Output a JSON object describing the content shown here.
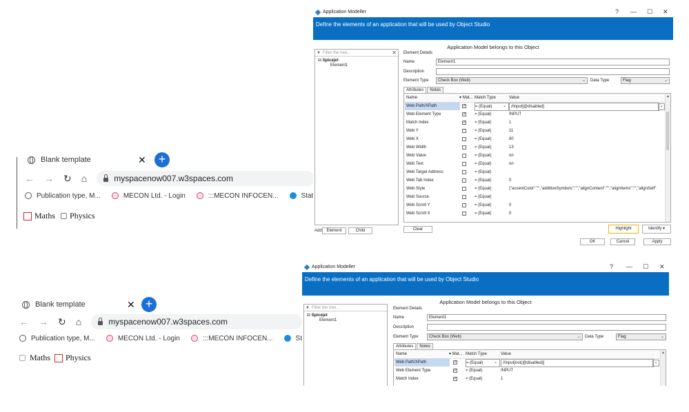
{
  "browser_top": {
    "tab_title": "Blank template",
    "tab_close": "✕",
    "new_tab": "+",
    "url": "myspacenow007.w3spaces.com",
    "bookmarks": [
      "Publication type, M...",
      "MECON Ltd. - Login",
      ":::MECON INFOCEN...",
      "State Bank of"
    ],
    "checkboxes": [
      {
        "label": "Maths",
        "checked": false,
        "highlighted": true
      },
      {
        "label": "Physics",
        "checked": false,
        "highlighted": false
      }
    ]
  },
  "browser_bottom": {
    "tab_title": "Blank template",
    "tab_close": "✕",
    "new_tab": "+",
    "url": "myspacenow007.w3spaces.com",
    "bookmarks": [
      "Publication type, M...",
      "MECON Ltd. - Login",
      ":::MECON INFOCEN...",
      "State Bank of Inc"
    ],
    "checkboxes": [
      {
        "label": "Maths",
        "checked": false,
        "highlighted": false
      },
      {
        "label": "Physics",
        "checked": false,
        "highlighted": true
      }
    ]
  },
  "modeller_top": {
    "title": "Application Modeller",
    "controls": [
      "?",
      "—",
      "☐",
      "✕"
    ],
    "banner": "Define the elements of an application that will be used by Object Studio",
    "subheader": "Application Model belongs to this Object",
    "filter_placeholder": "Filter the tree...",
    "tree_root": "Spicejet",
    "tree_child": "Element1",
    "element_details_label": "Element Details",
    "name_label": "Name",
    "name_value": "Element1",
    "description_label": "Description",
    "description_value": "",
    "element_type_label": "Element Type",
    "element_type_value": "Check Box (Web)",
    "data_type_label": "Data Type",
    "data_type_value": "Flag",
    "tabs": [
      "Attributes",
      "Notes"
    ],
    "columns": [
      "Name",
      "Mat...",
      "Match Type",
      "Value"
    ],
    "rows": [
      {
        "name": "Web Path/XPath",
        "match": true,
        "type": "= (Equal)",
        "value": "//input[@disabled]"
      },
      {
        "name": "Web Element Type",
        "match": true,
        "type": "= (Equal)",
        "value": "INPUT"
      },
      {
        "name": "Match Index",
        "match": true,
        "type": "= (Equal)",
        "value": "1"
      },
      {
        "name": "Web Y",
        "match": false,
        "type": "= (Equal)",
        "value": "11"
      },
      {
        "name": "Web X",
        "match": false,
        "type": "= (Equal)",
        "value": "80"
      },
      {
        "name": "Web Width",
        "match": false,
        "type": "= (Equal)",
        "value": "13"
      },
      {
        "name": "Web Value",
        "match": false,
        "type": "= (Equal)",
        "value": "on"
      },
      {
        "name": "Web Text",
        "match": false,
        "type": "= (Equal)",
        "value": "on"
      },
      {
        "name": "Web Target Address",
        "match": false,
        "type": "= (Equal)",
        "value": ""
      },
      {
        "name": "Web Tab Index",
        "match": false,
        "type": "= (Equal)",
        "value": "0"
      },
      {
        "name": "Web Style",
        "match": false,
        "type": "= (Equal)",
        "value": "{\"accentColor\":\"\",\"additiveSymbols\":\"\",\"alignContent\":\"\",\"alignItems\":\"\",\"alignSelf\":\"\",\"alig..."
      },
      {
        "name": "Web Source",
        "match": false,
        "type": "= (Equal)",
        "value": ""
      },
      {
        "name": "Web Scroll Y",
        "match": false,
        "type": "= (Equal)",
        "value": "0"
      },
      {
        "name": "Web Scroll X",
        "match": false,
        "type": "= (Equal)",
        "value": "0"
      }
    ],
    "add_label": "Add",
    "element_button": "Element",
    "child_button": "Child",
    "clear_button": "Clear",
    "highlight_button": "Highlight",
    "identify_button": "Identify",
    "ok_button": "OK",
    "cancel_button": "Cancel",
    "apply_button": "Apply"
  },
  "modeller_bottom": {
    "title": "Application Modeller",
    "controls": [
      "?",
      "—",
      "☐",
      "✕"
    ],
    "banner": "Define the elements of an application that will be used by Object Studio",
    "subheader": "Application Model belongs to this Object",
    "filter_placeholder": "Filter the tree...",
    "tree_root": "Spicejet",
    "tree_child": "Element1",
    "element_details_label": "Element Details",
    "name_label": "Name",
    "name_value": "Element1",
    "description_label": "Description",
    "description_value": "",
    "element_type_label": "Element Type",
    "element_type_value": "Check Box (Web)",
    "data_type_label": "Data Type",
    "data_type_value": "Flag",
    "tabs": [
      "Attributes",
      "Notes"
    ],
    "columns": [
      "Name",
      "Mat...",
      "Match Type",
      "Value"
    ],
    "rows": [
      {
        "name": "Web Path/XPath",
        "match": true,
        "type": "= (Equal)",
        "value": "//input[not(@disabled)]"
      },
      {
        "name": "Web Element Type",
        "match": true,
        "type": "= (Equal)",
        "value": "INPUT"
      },
      {
        "name": "Match Index",
        "match": true,
        "type": "= (Equal)",
        "value": "1"
      }
    ]
  }
}
